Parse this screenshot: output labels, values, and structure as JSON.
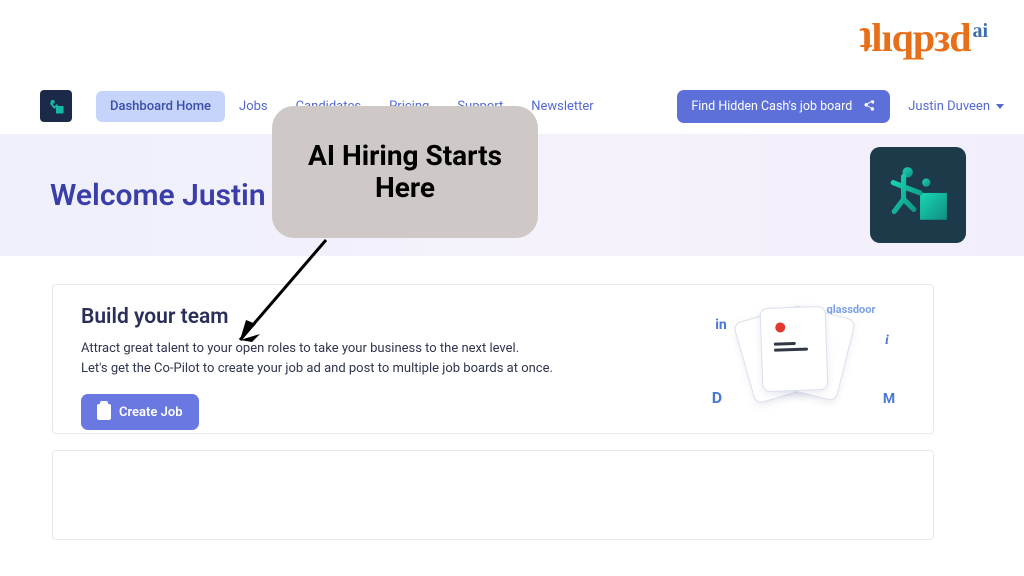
{
  "brand": {
    "name": "ʇlıqpᴈd",
    "tail": "ai"
  },
  "nav": {
    "items": [
      {
        "label": "Dashboard Home",
        "active": true
      },
      {
        "label": "Jobs"
      },
      {
        "label": "Candidates"
      },
      {
        "label": "Pricing"
      },
      {
        "label": "Support"
      },
      {
        "label": "Newsletter"
      }
    ],
    "share_label": "Find Hidden Cash's job board",
    "user_label": "Justin Duveen"
  },
  "hero": {
    "title": "Welcome Justin"
  },
  "card": {
    "title": "Build your team",
    "line1": "Attract great talent to your open roles to take your business to the next level.",
    "line2": "Let's get the Co-Pilot to create your job ad and post to multiple job boards at once.",
    "cta_label": "Create Job",
    "services": {
      "glassdoor": "glassdoor",
      "linkedin": "in",
      "indeed": "i",
      "drive": "D",
      "monster": "M"
    }
  },
  "callout": {
    "text": "AI Hiring Starts Here"
  }
}
